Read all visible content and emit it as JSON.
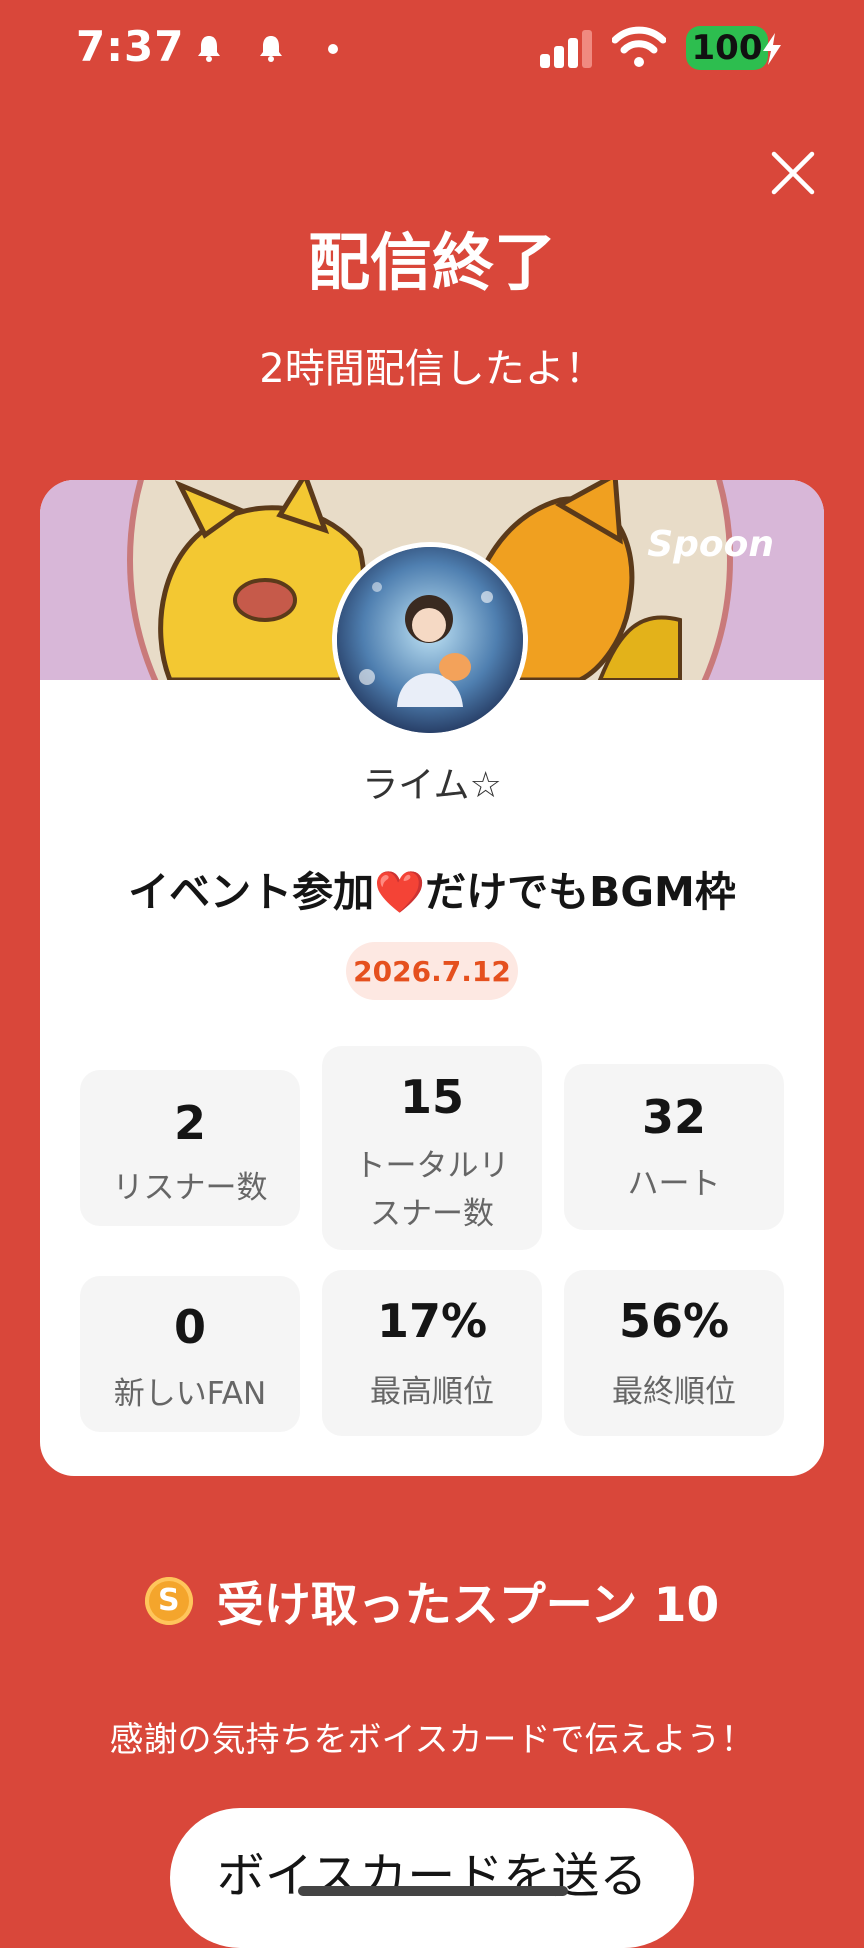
{
  "status_bar": {
    "time": "7:37",
    "battery": "100"
  },
  "header": {
    "title": "配信終了",
    "subtitle": "2時間配信したよ！"
  },
  "card": {
    "brand": "Spoon",
    "username": "ライム☆",
    "live_title": "イベント参加❤️だけでもBGM枠",
    "date": "2026.7.12",
    "stats": [
      {
        "value": "2",
        "label": "リスナー数"
      },
      {
        "value": "15",
        "label": "トータルリスナー数"
      },
      {
        "value": "32",
        "label": "ハート"
      },
      {
        "value": "0",
        "label": "新しいFAN"
      },
      {
        "value": "17%",
        "label": "最高順位"
      },
      {
        "value": "56%",
        "label": "最終順位"
      }
    ]
  },
  "spoons": {
    "coin_letter": "S",
    "text": "受け取ったスプーン 10"
  },
  "thanks_text": "感謝の気持ちをボイスカードで伝えよう！",
  "voice_card_button": "ボイスカードを送る",
  "colors": {
    "background": "#d9473a",
    "accent": "#e5501e",
    "battery": "#2dbe4f"
  }
}
